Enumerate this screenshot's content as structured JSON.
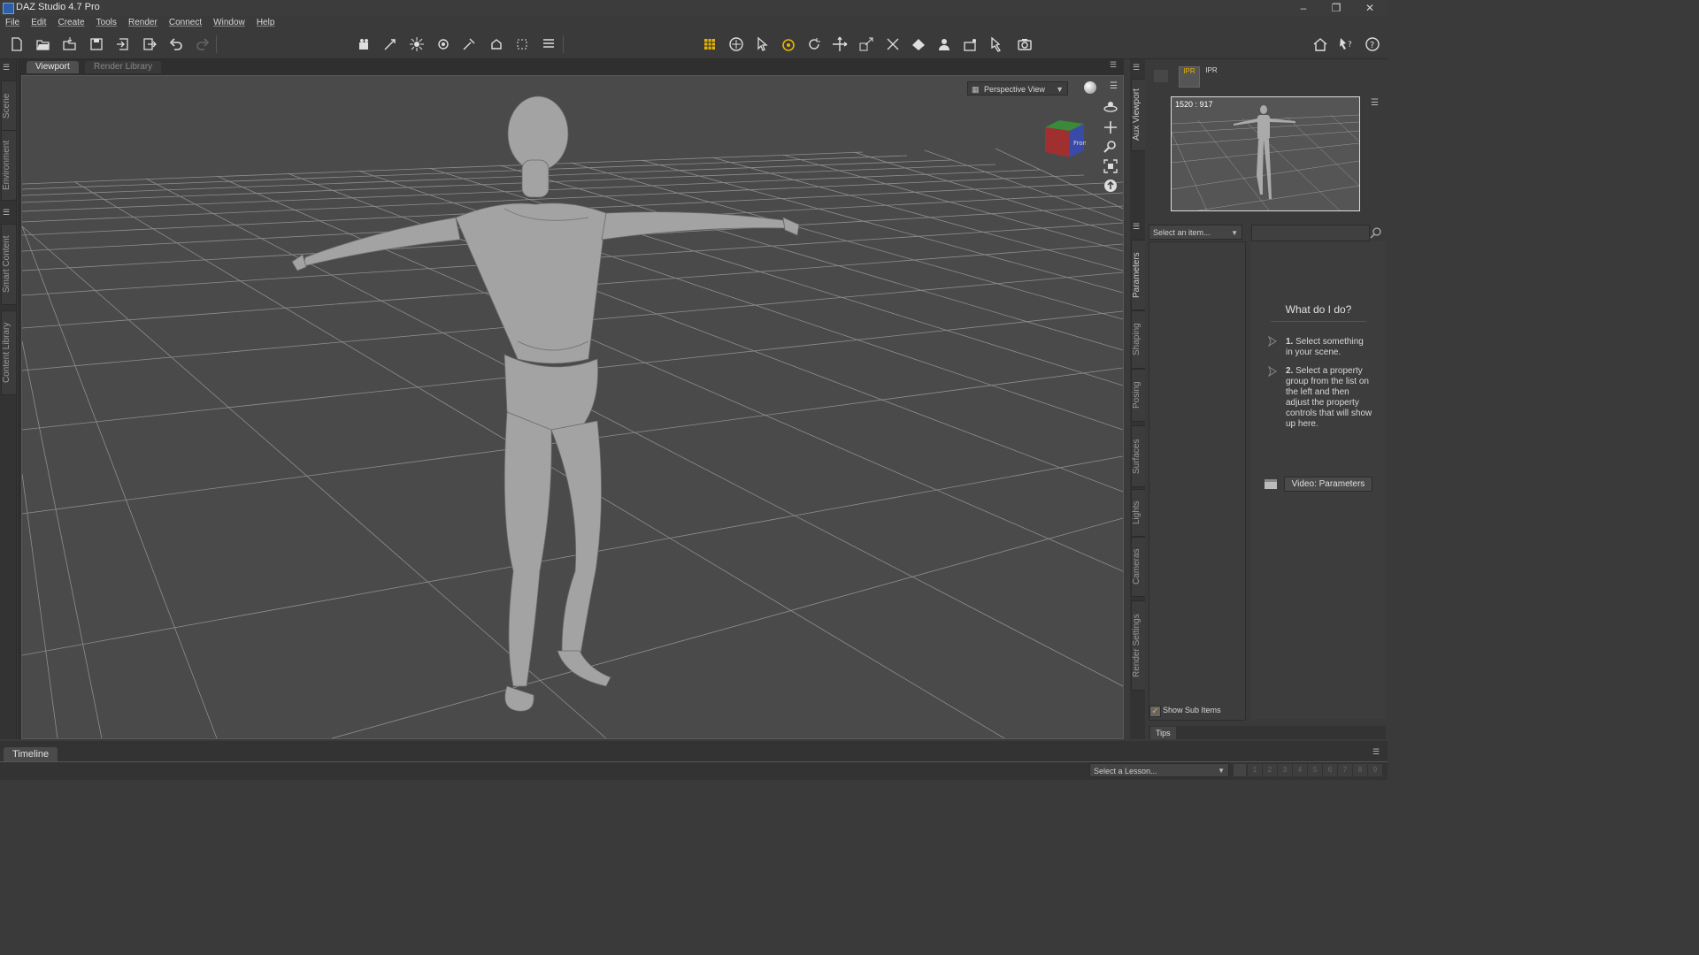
{
  "window": {
    "title": "DAZ Studio 4.7 Pro",
    "controls": {
      "minimize": "–",
      "maximize": "❐",
      "close": "✕"
    }
  },
  "menubar": {
    "items": [
      "File",
      "Edit",
      "Create",
      "Tools",
      "Render",
      "Connect",
      "Window",
      "Help"
    ]
  },
  "toolbar": {
    "left_icons": [
      "new-scene-icon",
      "open-icon",
      "merge-icon",
      "save-icon",
      "import-icon",
      "export-icon",
      "undo-icon",
      "redo-icon"
    ],
    "create_icons": [
      "create-camera-icon",
      "spotlight-icon",
      "point-light-icon",
      "distant-light-icon",
      "linear-point-light-icon",
      "create-primitive-icon",
      "node-weight-icon",
      "list-icon"
    ],
    "tool_icons": [
      "joint-editor-icon",
      "universal-tool-icon",
      "node-selection-icon",
      "active-pose-icon",
      "rotate-icon",
      "translate-icon",
      "scale-icon",
      "transform-icon",
      "surface-selection-icon",
      "geometry-editor-icon",
      "spot-render-icon",
      "pose-tool-icon",
      "render-icon"
    ],
    "right_icons": [
      "home-icon",
      "whats-this-icon",
      "help-icon"
    ]
  },
  "left_dock": {
    "tabs": [
      "Scene",
      "Environment",
      "Smart Content",
      "Content Library"
    ]
  },
  "viewport": {
    "tabs": [
      "Viewport",
      "Render Library"
    ],
    "active_tab": "Viewport",
    "view_select": "Perspective View",
    "cube_label": "Front",
    "side_icons": [
      "orbit-icon",
      "pan-icon",
      "zoom-icon",
      "frame-icon",
      "reset-icon"
    ]
  },
  "right_tabs": [
    "Aux Viewport",
    "Parameters",
    "Shaping",
    "Posing",
    "Surfaces",
    "Lights",
    "Cameras",
    "Render Settings"
  ],
  "aux_viewport": {
    "ipr_label_1": "IPR",
    "ipr_label_2": "IPR",
    "resolution": "1520 : 917"
  },
  "parameters": {
    "select_placeholder": "Select an item...",
    "help_title": "What do I do?",
    "step1_num": "1.",
    "step1_text": "Select something in your scene.",
    "step2_num": "2.",
    "step2_text": "Select a property group from the list on the left and then adjust the property controls that will show up here.",
    "video_button": "Video: Parameters",
    "show_sub_items": "Show Sub Items",
    "show_sub_items_checked": true,
    "tips_tab": "Tips"
  },
  "bottom": {
    "timeline_tab": "Timeline",
    "lesson_select": "Select a Lesson...",
    "lesson_steps": [
      "1",
      "2",
      "3",
      "4",
      "5",
      "6",
      "7",
      "8",
      "9"
    ]
  },
  "colors": {
    "background": "#3a3a3a",
    "viewport_bg": "#4a4a4a",
    "grid": "#a8a8a8",
    "figure": "#9c9c9c",
    "accent_yellow": "#e8b400"
  }
}
